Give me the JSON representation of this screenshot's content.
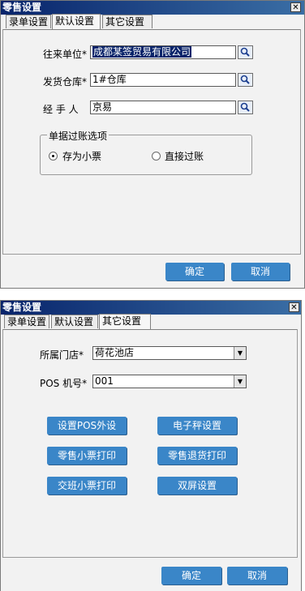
{
  "window1": {
    "title": "零售设置",
    "tabs": [
      "录单设置",
      "默认设置",
      "其它设置"
    ],
    "fields": {
      "partner_label": "往来单位*",
      "partner_value": "成都某签贸易有限公司",
      "warehouse_label": "发货仓库*",
      "warehouse_value": "1#仓库",
      "handler_label": "经 手 人",
      "handler_value": "京易"
    },
    "group": {
      "title": "单据过账选项",
      "option_save": "存为小票",
      "option_post": "直接过账",
      "selected": "存为小票"
    },
    "ok": "确定",
    "cancel": "取消"
  },
  "window2": {
    "title": "零售设置",
    "tabs": [
      "录单设置",
      "默认设置",
      "其它设置"
    ],
    "store_label": "所属门店*",
    "store_value": "荷花池店",
    "pos_label": "POS 机号*",
    "pos_value": "001",
    "buttons": [
      "设置POS外设",
      "电子秤设置",
      "零售小票打印",
      "零售退货打印",
      "交班小票打印",
      "双屏设置"
    ],
    "ok": "确定",
    "cancel": "取消"
  },
  "colors": {
    "titlebar": "#08246b",
    "button": "#3a86c8"
  },
  "icons": {
    "close": "close-icon",
    "search": "search-icon",
    "dropdown": "chevron-down-icon"
  }
}
